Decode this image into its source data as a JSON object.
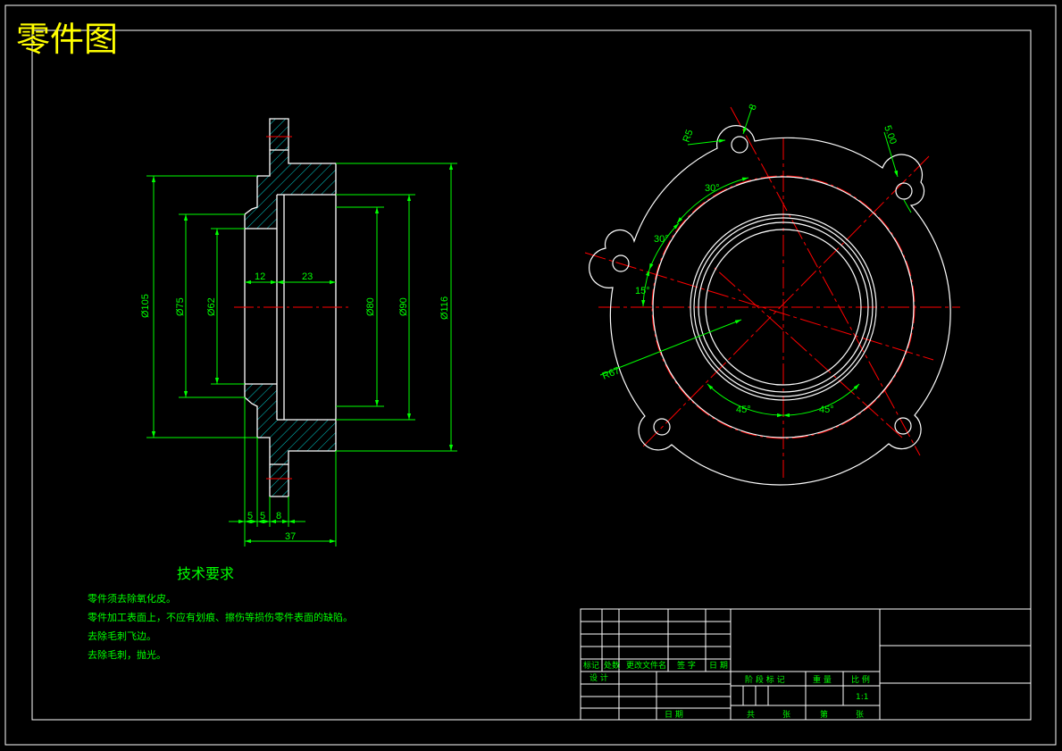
{
  "title": "零件图",
  "colors": {
    "background": "#000000",
    "outline": "#ffffff",
    "dimension": "#00ff00",
    "centerline": "#ff0000",
    "hatch": "#00cccc",
    "title": "#ffff00"
  },
  "section_view": {
    "diameters": [
      "Ø105",
      "Ø75",
      "Ø62",
      "Ø80",
      "Ø90",
      "Ø116"
    ],
    "lengths": [
      "12",
      "23",
      "5",
      "5",
      "8",
      "37"
    ]
  },
  "front_view": {
    "labels": [
      "R5",
      "8",
      "5.00",
      "30°",
      "30°",
      "15°",
      "R67",
      "45°",
      "45°"
    ]
  },
  "tech_req": {
    "title": "技术要求",
    "items": [
      "零件须去除氧化皮。",
      "零件加工表面上，不应有划痕、擦伤等损伤零件表面的缺陷。",
      "去除毛刺飞边。",
      "去除毛刺，抛光。"
    ]
  },
  "title_block": {
    "rev_headers": [
      "标记",
      "处数",
      "更改文件名",
      "签 字",
      "日 期"
    ],
    "design": "设 计",
    "date": "日 期",
    "stage_mark": "阶 段 标 记",
    "weight": "重 量",
    "scale": "比 例",
    "scale_value": "1:1",
    "sheets_total": "共",
    "sheets": "张",
    "sheet_no": "第",
    "sheet_unit": "张"
  }
}
